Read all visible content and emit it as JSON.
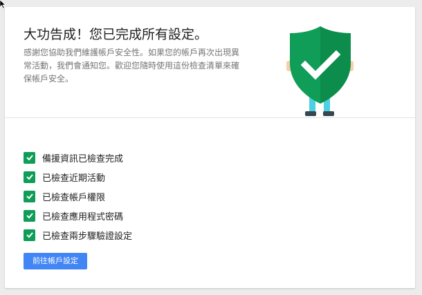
{
  "header": {
    "title": "大功告成！您已完成所有設定。",
    "description": "感謝您協助我們維護帳戶安全性。如果您的帳戶再次出現異常活動，我們會通知您。歡迎您隨時使用這份檢查清單來確保帳戶安全。"
  },
  "illustration": {
    "icon": "shield-check-icon",
    "shield_color": "#0f9d58",
    "shield_shadow_color": "#0b8043",
    "legs_color": "#4dd0e1",
    "shoes_color": "#37474f",
    "hands_color": "#f5d0a9"
  },
  "checklist": {
    "items": [
      {
        "label": "備援資訊已檢查完成",
        "checked": true
      },
      {
        "label": "已檢查近期活動",
        "checked": true
      },
      {
        "label": "已檢查帳戶權限",
        "checked": true
      },
      {
        "label": "已檢查應用程式密碼",
        "checked": true
      },
      {
        "label": "已檢查兩步驟驗證設定",
        "checked": true
      }
    ],
    "check_color": "#0f9d58"
  },
  "actions": {
    "go_to_account_settings": "前往帳戶設定",
    "button_color": "#4285f4"
  }
}
